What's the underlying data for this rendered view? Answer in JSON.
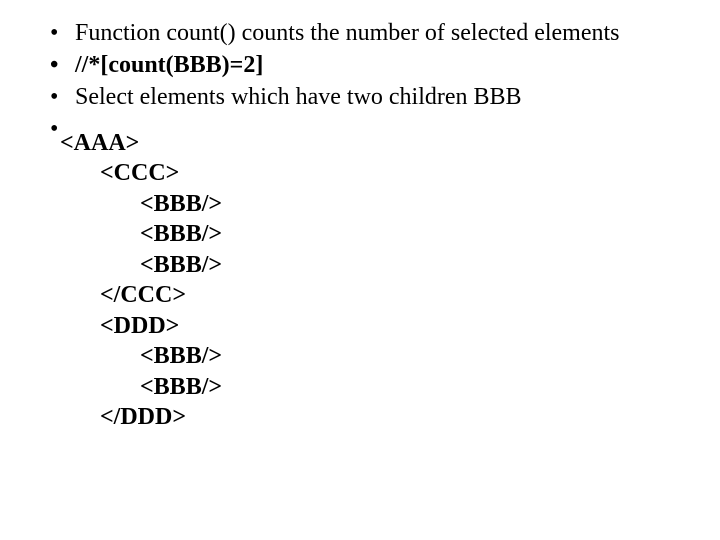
{
  "bullets": {
    "b1": "Function count() counts the number of selected elements",
    "b2": " //*[count(BBB)=2]",
    "b3": "Select elements which have two children BBB",
    "b4": ""
  },
  "code": {
    "l1": "<AAA>",
    "l2": "<CCC>",
    "l3": "<BBB/>",
    "l4": "<BBB/>",
    "l5": "<BBB/>",
    "l6": "</CCC>",
    "l7": "<DDD>",
    "l8": "<BBB/>",
    "l9": "<BBB/>",
    "l10": "</DDD>"
  }
}
